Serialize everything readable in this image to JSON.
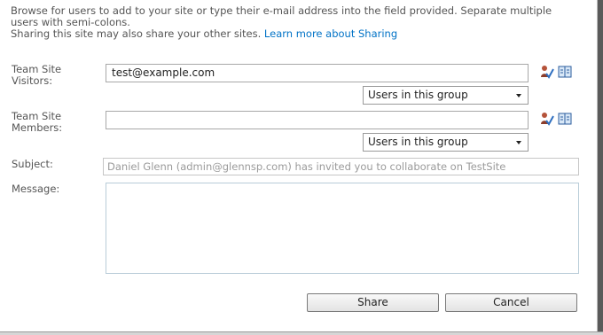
{
  "intro": {
    "text": "Browse for users to add to your site or type their e-mail address into the field provided. Separate multiple users with semi-colons.",
    "sharing_text": "Sharing this site may also share your other sites.",
    "learn_more_link": "Learn more about Sharing"
  },
  "visitors": {
    "label_line1": "Team Site",
    "label_line2": "Visitors:",
    "value": "test@example.com",
    "group_select": "Users in this group"
  },
  "members": {
    "label_line1": "Team Site",
    "label_line2": "Members:",
    "value": "",
    "group_select": "Users in this group"
  },
  "subject": {
    "label": "Subject:",
    "value": "Daniel Glenn (admin@glennsp.com) has invited you to collaborate on TestSite"
  },
  "message": {
    "label": "Message:",
    "value": ""
  },
  "buttons": {
    "share": "Share",
    "cancel": "Cancel"
  },
  "icons": {
    "check_names": "check-names-icon",
    "browse": "address-book-icon"
  }
}
